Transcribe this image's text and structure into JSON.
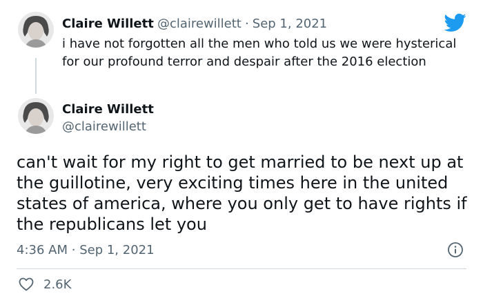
{
  "reply": {
    "author_name": "Claire Willett",
    "handle": "@clairewillett",
    "separator": "·",
    "date": "Sep 1, 2021",
    "text": "i have not forgotten all the men who told us we were hysterical for our profound terror and despair after the 2016 election"
  },
  "main": {
    "author_name": "Claire Willett",
    "handle": "@clairewillett",
    "text": "can't wait for my right to get married to be next up at the guillotine, very exciting times here in the united states of america, where you only get to have rights if the republicans let you",
    "time": "4:36 AM",
    "separator": "·",
    "date": "Sep 1, 2021",
    "likes": "2.6K"
  },
  "icons": {
    "brand": "twitter-bird-icon",
    "info": "info-icon",
    "like": "heart-icon"
  },
  "colors": {
    "brand": "#1d9bf0",
    "text": "#0f1419",
    "secondary": "#536471",
    "divider": "#cfd9de"
  }
}
